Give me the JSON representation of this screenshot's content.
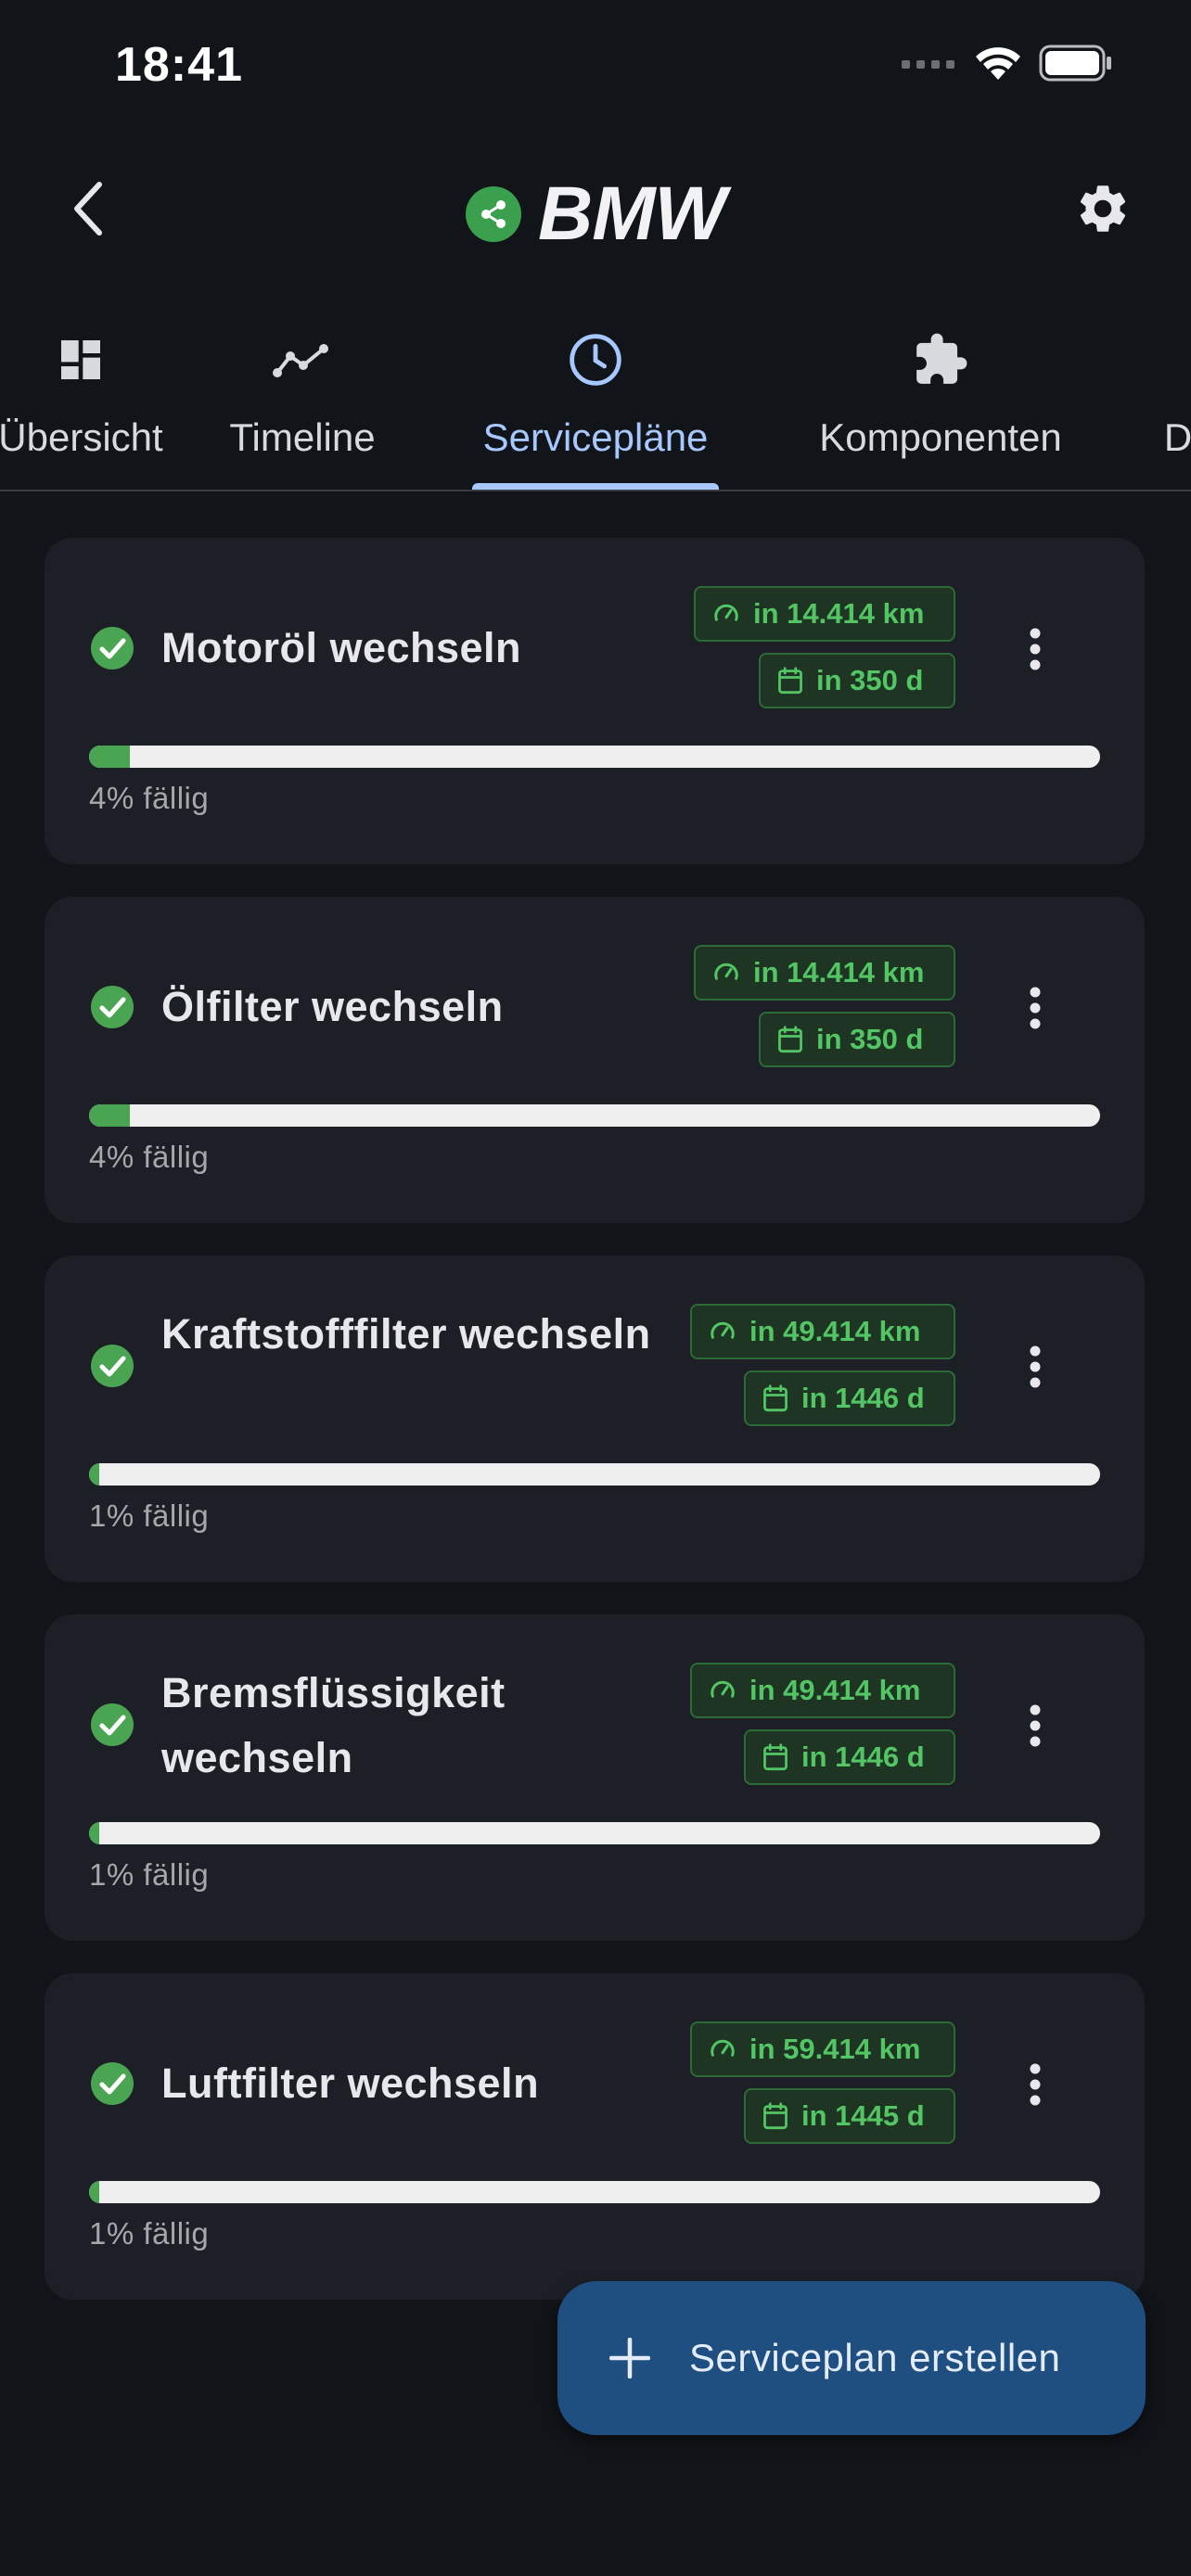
{
  "status_bar": {
    "time": "18:41"
  },
  "app_bar": {
    "title": "BMW"
  },
  "tabs": [
    {
      "label": "Übersicht",
      "icon": "dashboard-icon"
    },
    {
      "label": "Timeline",
      "icon": "timeline-icon"
    },
    {
      "label": "Servicepläne",
      "icon": "clock-icon",
      "active": true
    },
    {
      "label": "Komponenten",
      "icon": "puzzle-icon"
    },
    {
      "label": "D",
      "icon": "none"
    }
  ],
  "service_plans": [
    {
      "title": "Motoröl wechseln",
      "km": "in 14.414 km",
      "days": "in 350 d",
      "progress": 4,
      "due": "4% fällig"
    },
    {
      "title": "Ölfilter wechseln",
      "km": "in 14.414 km",
      "days": "in 350 d",
      "progress": 4,
      "due": "4% fällig"
    },
    {
      "title": "Kraftstofffilter wechseln",
      "km": "in 49.414 km",
      "days": "in 1446 d",
      "progress": 1,
      "due": "1% fällig"
    },
    {
      "title": "Bremsflüssigkeit wechseln",
      "km": "in 49.414 km",
      "days": "in 1446 d",
      "progress": 1,
      "due": "1% fällig"
    },
    {
      "title": "Luftfilter wechseln",
      "km": "in 59.414 km",
      "days": "in 1445 d",
      "progress": 1,
      "due": "1% fällig"
    }
  ],
  "fab": {
    "label": "Serviceplan erstellen"
  },
  "colors": {
    "accent": "#a7c8ff",
    "success": "#4aa552",
    "chip_text": "#53c565",
    "fab": "#1f4f80",
    "background": "#111418",
    "card": "#1c1f25"
  }
}
